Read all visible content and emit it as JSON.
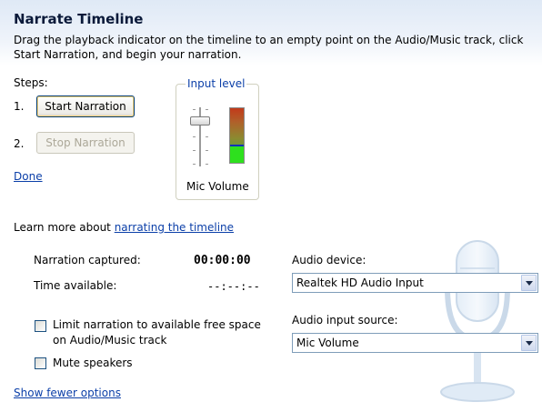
{
  "header": {
    "title": "Narrate Timeline",
    "description": "Drag the playback indicator on the timeline to an empty point on the Audio/Music track, click Start Narration, and begin your narration."
  },
  "steps": {
    "label": "Steps:",
    "step1_number": "1.",
    "step2_number": "2.",
    "start_button": "Start Narration",
    "stop_button": "Stop Narration",
    "done_link": "Done"
  },
  "input_level": {
    "legend": "Input level",
    "slider_label": "Mic Volume",
    "slider_icon": "volume-slider-icon",
    "meter_icon": "level-meter-icon"
  },
  "learn_more": {
    "prefix": "Learn more about ",
    "link": "narrating the timeline"
  },
  "stats": {
    "captured_label": "Narration captured:",
    "captured_value": "00:00:00",
    "available_label": "Time available:",
    "available_value": "--:--:--"
  },
  "options": {
    "limit_label_line1": "Limit narration to available free space",
    "limit_label_line2": "on Audio/Music track",
    "limit_checked": false,
    "mute_label": "Mute speakers",
    "mute_checked": false,
    "fewer_options_link": "Show fewer options"
  },
  "audio": {
    "device_label": "Audio device:",
    "device_value": "Realtek HD Audio Input",
    "source_label": "Audio input source:",
    "source_value": "Mic Volume"
  },
  "decor": {
    "watermark_icon": "microphone-icon"
  },
  "colors": {
    "link": "#0b3fa8",
    "header_bg": "#dfe9f6",
    "title": "#0b1a3a"
  }
}
